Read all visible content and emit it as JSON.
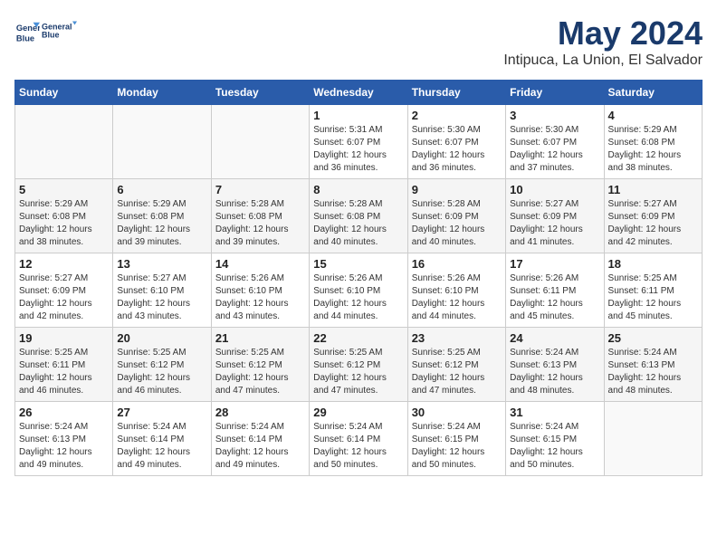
{
  "header": {
    "logo_line1": "General",
    "logo_line2": "Blue",
    "month": "May 2024",
    "location": "Intipuca, La Union, El Salvador"
  },
  "days_of_week": [
    "Sunday",
    "Monday",
    "Tuesday",
    "Wednesday",
    "Thursday",
    "Friday",
    "Saturday"
  ],
  "weeks": [
    [
      {
        "day": "",
        "sunrise": "",
        "sunset": "",
        "daylight": ""
      },
      {
        "day": "",
        "sunrise": "",
        "sunset": "",
        "daylight": ""
      },
      {
        "day": "",
        "sunrise": "",
        "sunset": "",
        "daylight": ""
      },
      {
        "day": "1",
        "sunrise": "Sunrise: 5:31 AM",
        "sunset": "Sunset: 6:07 PM",
        "daylight": "Daylight: 12 hours and 36 minutes."
      },
      {
        "day": "2",
        "sunrise": "Sunrise: 5:30 AM",
        "sunset": "Sunset: 6:07 PM",
        "daylight": "Daylight: 12 hours and 36 minutes."
      },
      {
        "day": "3",
        "sunrise": "Sunrise: 5:30 AM",
        "sunset": "Sunset: 6:07 PM",
        "daylight": "Daylight: 12 hours and 37 minutes."
      },
      {
        "day": "4",
        "sunrise": "Sunrise: 5:29 AM",
        "sunset": "Sunset: 6:08 PM",
        "daylight": "Daylight: 12 hours and 38 minutes."
      }
    ],
    [
      {
        "day": "5",
        "sunrise": "Sunrise: 5:29 AM",
        "sunset": "Sunset: 6:08 PM",
        "daylight": "Daylight: 12 hours and 38 minutes."
      },
      {
        "day": "6",
        "sunrise": "Sunrise: 5:29 AM",
        "sunset": "Sunset: 6:08 PM",
        "daylight": "Daylight: 12 hours and 39 minutes."
      },
      {
        "day": "7",
        "sunrise": "Sunrise: 5:28 AM",
        "sunset": "Sunset: 6:08 PM",
        "daylight": "Daylight: 12 hours and 39 minutes."
      },
      {
        "day": "8",
        "sunrise": "Sunrise: 5:28 AM",
        "sunset": "Sunset: 6:08 PM",
        "daylight": "Daylight: 12 hours and 40 minutes."
      },
      {
        "day": "9",
        "sunrise": "Sunrise: 5:28 AM",
        "sunset": "Sunset: 6:09 PM",
        "daylight": "Daylight: 12 hours and 40 minutes."
      },
      {
        "day": "10",
        "sunrise": "Sunrise: 5:27 AM",
        "sunset": "Sunset: 6:09 PM",
        "daylight": "Daylight: 12 hours and 41 minutes."
      },
      {
        "day": "11",
        "sunrise": "Sunrise: 5:27 AM",
        "sunset": "Sunset: 6:09 PM",
        "daylight": "Daylight: 12 hours and 42 minutes."
      }
    ],
    [
      {
        "day": "12",
        "sunrise": "Sunrise: 5:27 AM",
        "sunset": "Sunset: 6:09 PM",
        "daylight": "Daylight: 12 hours and 42 minutes."
      },
      {
        "day": "13",
        "sunrise": "Sunrise: 5:27 AM",
        "sunset": "Sunset: 6:10 PM",
        "daylight": "Daylight: 12 hours and 43 minutes."
      },
      {
        "day": "14",
        "sunrise": "Sunrise: 5:26 AM",
        "sunset": "Sunset: 6:10 PM",
        "daylight": "Daylight: 12 hours and 43 minutes."
      },
      {
        "day": "15",
        "sunrise": "Sunrise: 5:26 AM",
        "sunset": "Sunset: 6:10 PM",
        "daylight": "Daylight: 12 hours and 44 minutes."
      },
      {
        "day": "16",
        "sunrise": "Sunrise: 5:26 AM",
        "sunset": "Sunset: 6:10 PM",
        "daylight": "Daylight: 12 hours and 44 minutes."
      },
      {
        "day": "17",
        "sunrise": "Sunrise: 5:26 AM",
        "sunset": "Sunset: 6:11 PM",
        "daylight": "Daylight: 12 hours and 45 minutes."
      },
      {
        "day": "18",
        "sunrise": "Sunrise: 5:25 AM",
        "sunset": "Sunset: 6:11 PM",
        "daylight": "Daylight: 12 hours and 45 minutes."
      }
    ],
    [
      {
        "day": "19",
        "sunrise": "Sunrise: 5:25 AM",
        "sunset": "Sunset: 6:11 PM",
        "daylight": "Daylight: 12 hours and 46 minutes."
      },
      {
        "day": "20",
        "sunrise": "Sunrise: 5:25 AM",
        "sunset": "Sunset: 6:12 PM",
        "daylight": "Daylight: 12 hours and 46 minutes."
      },
      {
        "day": "21",
        "sunrise": "Sunrise: 5:25 AM",
        "sunset": "Sunset: 6:12 PM",
        "daylight": "Daylight: 12 hours and 47 minutes."
      },
      {
        "day": "22",
        "sunrise": "Sunrise: 5:25 AM",
        "sunset": "Sunset: 6:12 PM",
        "daylight": "Daylight: 12 hours and 47 minutes."
      },
      {
        "day": "23",
        "sunrise": "Sunrise: 5:25 AM",
        "sunset": "Sunset: 6:12 PM",
        "daylight": "Daylight: 12 hours and 47 minutes."
      },
      {
        "day": "24",
        "sunrise": "Sunrise: 5:24 AM",
        "sunset": "Sunset: 6:13 PM",
        "daylight": "Daylight: 12 hours and 48 minutes."
      },
      {
        "day": "25",
        "sunrise": "Sunrise: 5:24 AM",
        "sunset": "Sunset: 6:13 PM",
        "daylight": "Daylight: 12 hours and 48 minutes."
      }
    ],
    [
      {
        "day": "26",
        "sunrise": "Sunrise: 5:24 AM",
        "sunset": "Sunset: 6:13 PM",
        "daylight": "Daylight: 12 hours and 49 minutes."
      },
      {
        "day": "27",
        "sunrise": "Sunrise: 5:24 AM",
        "sunset": "Sunset: 6:14 PM",
        "daylight": "Daylight: 12 hours and 49 minutes."
      },
      {
        "day": "28",
        "sunrise": "Sunrise: 5:24 AM",
        "sunset": "Sunset: 6:14 PM",
        "daylight": "Daylight: 12 hours and 49 minutes."
      },
      {
        "day": "29",
        "sunrise": "Sunrise: 5:24 AM",
        "sunset": "Sunset: 6:14 PM",
        "daylight": "Daylight: 12 hours and 50 minutes."
      },
      {
        "day": "30",
        "sunrise": "Sunrise: 5:24 AM",
        "sunset": "Sunset: 6:15 PM",
        "daylight": "Daylight: 12 hours and 50 minutes."
      },
      {
        "day": "31",
        "sunrise": "Sunrise: 5:24 AM",
        "sunset": "Sunset: 6:15 PM",
        "daylight": "Daylight: 12 hours and 50 minutes."
      },
      {
        "day": "",
        "sunrise": "",
        "sunset": "",
        "daylight": ""
      }
    ]
  ]
}
